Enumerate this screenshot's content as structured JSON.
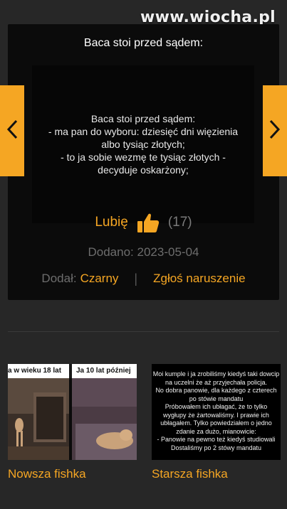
{
  "watermark": "www.wiocha.pl",
  "joke": {
    "title": "Baca stoi przed sądem:",
    "lines": [
      "Baca stoi przed sądem:",
      "- ma pan do wyboru: dziesięć dni więzienia",
      "albo tysiąc złotych;",
      "- to ja sobie wezmę te tysiąc złotych -",
      "decyduje oskarżony;"
    ]
  },
  "like": {
    "label": "Lubię",
    "icon": "thumbs-up-icon",
    "count": "(17)"
  },
  "added": {
    "label": "Dodano:",
    "date": "2023-05-04"
  },
  "author": {
    "label": "Dodał:",
    "name": "Czarny"
  },
  "report_label": "Zgłoś naruszenie",
  "nav": {
    "prev_icon": "chevron-left-icon",
    "next_icon": "chevron-right-icon"
  },
  "related": {
    "newer": {
      "caption": "Nowsza fishka",
      "labels": [
        "a w wieku 18 lat",
        "Ja 10 lat później"
      ]
    },
    "older": {
      "caption": "Starsza fishka",
      "lines": [
        "Moi kumple i ja zrobiliśmy kiedyś taki dowcip",
        "na uczelni że aż przyjechała policja.",
        "No dobra panowie, dla każdego z czterech",
        "po stówie mandatu",
        "Próbowałem ich ubłagać, że to tylko",
        "wygłupy że żartowaliśmy. I prawie ich",
        "ubłagałem. Tylko powiedziałem o jedno",
        "zdanie za dużo, mianowicie:",
        "- Panowie na pewno też kiedyś studiowali",
        "Dostaliśmy po 2 stówy mandatu"
      ]
    }
  },
  "colors": {
    "accent": "#f5a623",
    "background": "#272727",
    "card": "#0b0b0b"
  }
}
